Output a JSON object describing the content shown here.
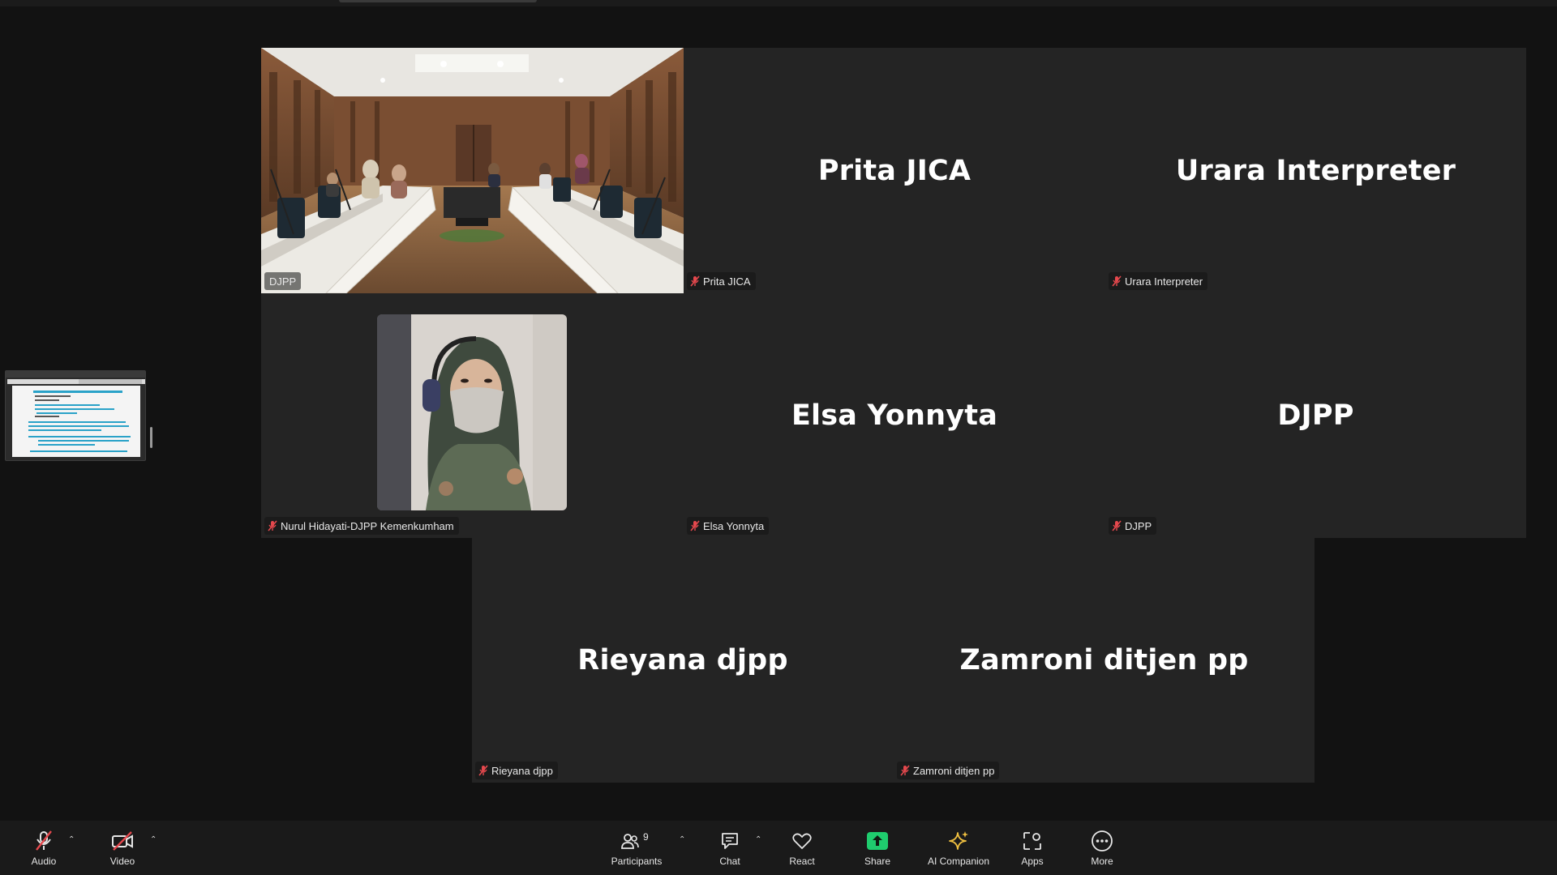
{
  "participants": [
    {
      "tile_name": "",
      "label": "DJPP",
      "muted": false,
      "video": "room"
    },
    {
      "tile_name": "Prita JICA",
      "label": "Prita JICA",
      "muted": true
    },
    {
      "tile_name": "Urara Interpreter",
      "label": "Urara Interpreter",
      "muted": true
    },
    {
      "tile_name": "",
      "label": "Nurul Hidayati-DJPP Kemenkumham",
      "muted": true,
      "video": "face"
    },
    {
      "tile_name": "Elsa Yonnyta",
      "label": "Elsa Yonnyta",
      "muted": true
    },
    {
      "tile_name": "DJPP",
      "label": "DJPP",
      "muted": true
    },
    {
      "tile_name": "Rieyana djpp",
      "label": "Rieyana djpp",
      "muted": true
    },
    {
      "tile_name": "Zamroni ditjen pp",
      "label": "Zamroni ditjen pp",
      "muted": true
    }
  ],
  "toolbar": {
    "audio": "Audio",
    "video": "Video",
    "participants": "Participants",
    "participants_count": "9",
    "chat": "Chat",
    "react": "React",
    "share": "Share",
    "ai_companion": "AI Companion",
    "apps": "Apps",
    "more": "More"
  },
  "colors": {
    "active_speaker": "#2bd36b",
    "share_icon": "#1fcc6e",
    "muted_icon": "#e5484d",
    "ai_companion": "#f0c040"
  }
}
